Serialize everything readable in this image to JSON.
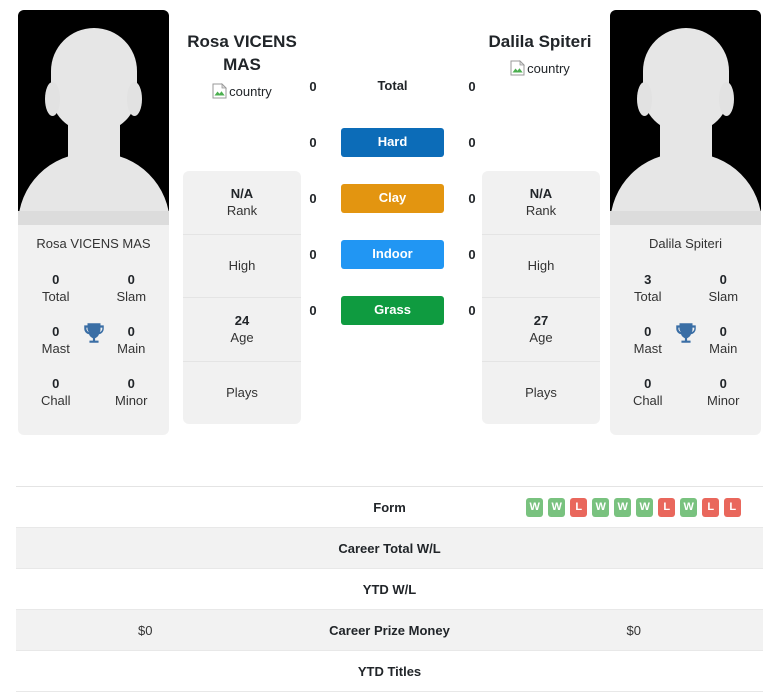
{
  "colors": {
    "hard": "#0c6cb8",
    "clay": "#e39510",
    "indoor": "#2196f3",
    "grass": "#0f9b40",
    "win": "#79c27f",
    "loss": "#e9675c",
    "trophy": "#3a6ea5",
    "card_bg": "#f1f1f1",
    "row_alt": "#f2f2f2"
  },
  "players": {
    "left": {
      "name": "Rosa VICENS MAS",
      "photo_caption": "Rosa VICENS MAS",
      "country_alt": "country",
      "titles": [
        {
          "value": "0",
          "label": "Total"
        },
        {
          "value": "0",
          "label": "Slam"
        },
        {
          "value": "0",
          "label": "Mast"
        },
        {
          "value": "0",
          "label": "Main"
        },
        {
          "value": "0",
          "label": "Chall"
        },
        {
          "value": "0",
          "label": "Minor"
        }
      ],
      "info": {
        "rank_value": "N/A",
        "rank_label": "Rank",
        "high_label": "High",
        "age_value": "24",
        "age_label": "Age",
        "plays_label": "Plays"
      }
    },
    "right": {
      "name": "Dalila Spiteri",
      "photo_caption": "Dalila Spiteri",
      "country_alt": "country",
      "titles": [
        {
          "value": "3",
          "label": "Total"
        },
        {
          "value": "0",
          "label": "Slam"
        },
        {
          "value": "0",
          "label": "Mast"
        },
        {
          "value": "0",
          "label": "Main"
        },
        {
          "value": "0",
          "label": "Chall"
        },
        {
          "value": "0",
          "label": "Minor"
        }
      ],
      "info": {
        "rank_value": "N/A",
        "rank_label": "Rank",
        "high_label": "High",
        "age_value": "27",
        "age_label": "Age",
        "plays_label": "Plays"
      }
    }
  },
  "surfaces": [
    {
      "label": "Total",
      "left": "0",
      "right": "0",
      "color": "transparent",
      "plain": true
    },
    {
      "label": "Hard",
      "left": "0",
      "right": "0",
      "color": "#0c6cb8",
      "plain": false
    },
    {
      "label": "Clay",
      "left": "0",
      "right": "0",
      "color": "#e39510",
      "plain": false
    },
    {
      "label": "Indoor",
      "left": "0",
      "right": "0",
      "color": "#2196f3",
      "plain": false
    },
    {
      "label": "Grass",
      "left": "0",
      "right": "0",
      "color": "#0f9b40",
      "plain": false
    }
  ],
  "stats_table": {
    "rows": [
      {
        "label": "Form",
        "left_text": "",
        "right_text": "",
        "left_form": [],
        "right_form": [
          "W",
          "W",
          "L",
          "W",
          "W",
          "W",
          "L",
          "W",
          "L",
          "L"
        ]
      },
      {
        "label": "Career Total W/L",
        "left_text": "",
        "right_text": "",
        "left_form": [],
        "right_form": []
      },
      {
        "label": "YTD W/L",
        "left_text": "",
        "right_text": "",
        "left_form": [],
        "right_form": []
      },
      {
        "label": "Career Prize Money",
        "left_text": "$0",
        "right_text": "$0",
        "left_form": [],
        "right_form": []
      },
      {
        "label": "YTD Titles",
        "left_text": "",
        "right_text": "",
        "left_form": [],
        "right_form": []
      }
    ]
  }
}
